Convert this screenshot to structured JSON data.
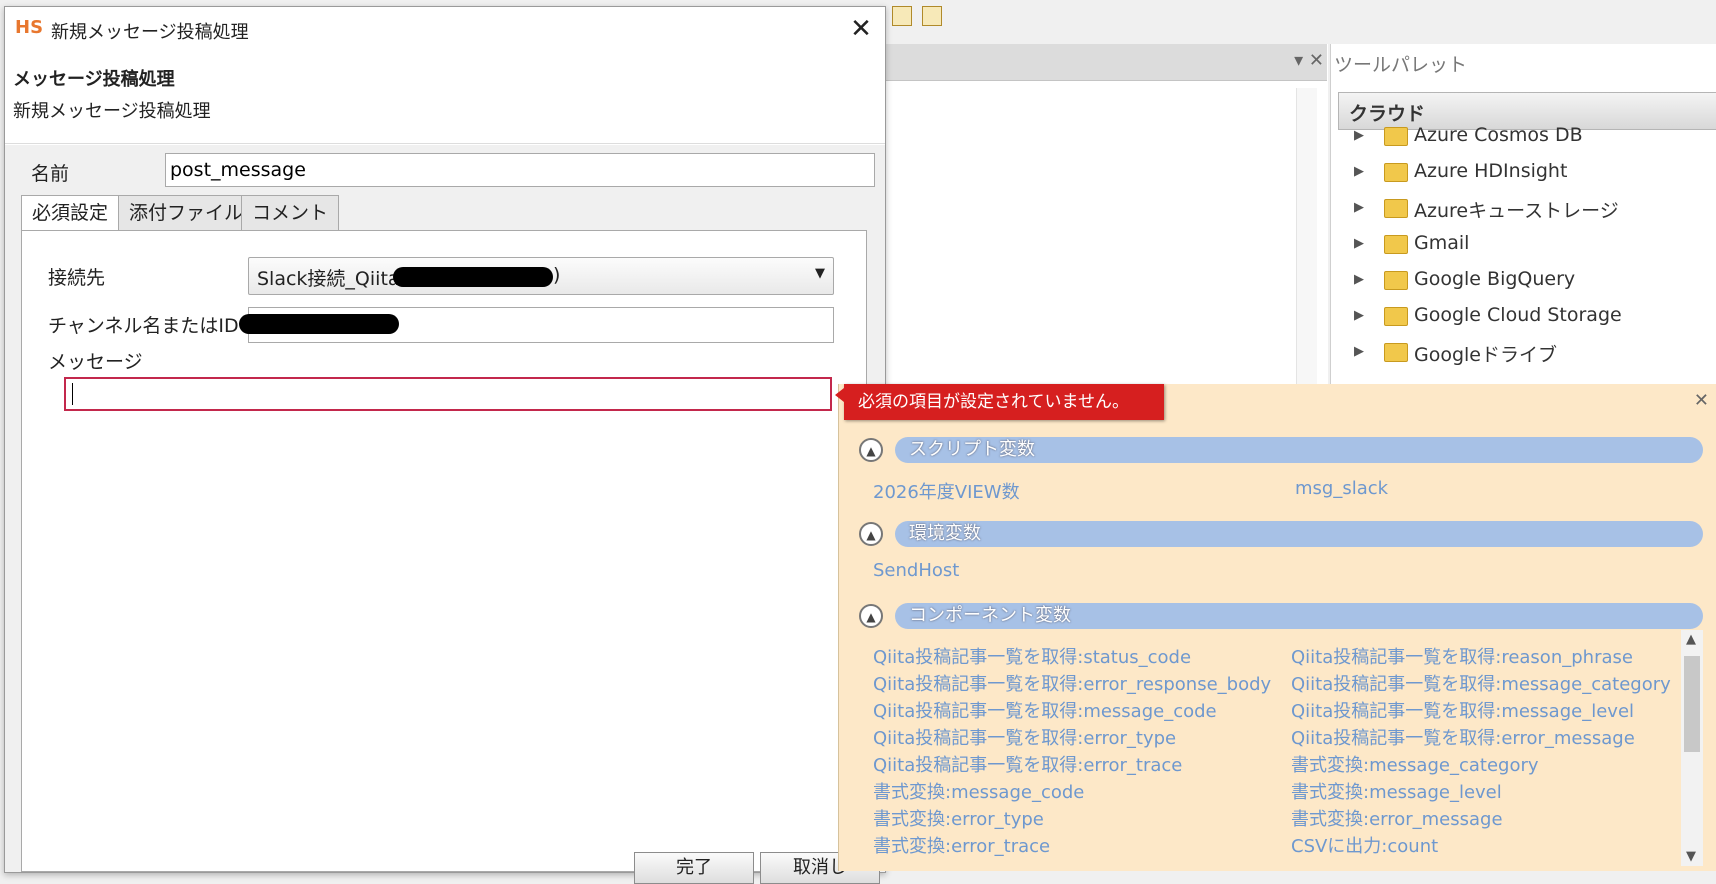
{
  "palette": {
    "title": "ツールパレット",
    "category": "クラウド",
    "items": [
      "Azure Cosmos DB",
      "Azure HDInsight",
      "Azureキューストレージ",
      "Gmail",
      "Google BigQuery",
      "Google Cloud Storage",
      "Googleドライブ"
    ]
  },
  "dialog": {
    "logo": "HS",
    "title": "新規メッセージ投稿処理",
    "heading": "メッセージ投稿処理",
    "subheading": "新規メッセージ投稿処理",
    "name_label": "名前",
    "name_value": "post_message",
    "tabs": [
      "必須設定",
      "添付ファイル",
      "コメント"
    ],
    "connection_label": "接続先",
    "connection_value": "Slack接続_Qiita",
    "connection_suffix": ")",
    "channel_label": "チャンネル名またはID",
    "message_label": "メッセージ",
    "finish_button": "完了",
    "cancel_button": "取消し"
  },
  "error": {
    "text": "必須の項目が設定されていません。"
  },
  "variables": {
    "script": {
      "title": "スクリプト変数",
      "items": [
        "2026年度VIEW数",
        "msg_slack"
      ]
    },
    "env": {
      "title": "環境変数",
      "items": [
        "SendHost"
      ]
    },
    "component": {
      "title": "コンポーネント変数",
      "left": [
        "Qiita投稿記事一覧を取得:status_code",
        "Qiita投稿記事一覧を取得:error_response_body",
        "Qiita投稿記事一覧を取得:message_code",
        "Qiita投稿記事一覧を取得:error_type",
        "Qiita投稿記事一覧を取得:error_trace",
        "書式変換:message_code",
        "書式変換:error_type",
        "書式変換:error_trace"
      ],
      "right": [
        "Qiita投稿記事一覧を取得:reason_phrase",
        "Qiita投稿記事一覧を取得:message_category",
        "Qiita投稿記事一覧を取得:message_level",
        "Qiita投稿記事一覧を取得:error_message",
        "書式変換:message_category",
        "書式変換:message_level",
        "書式変換:error_message",
        "CSVに出力:count"
      ]
    }
  },
  "colors": {
    "error_red": "#d61f1f",
    "panel_bg": "#fde8c8",
    "section_bar": "#a7c1e6",
    "variable_link": "#6e98cf",
    "logo_orange": "#e8772e"
  }
}
